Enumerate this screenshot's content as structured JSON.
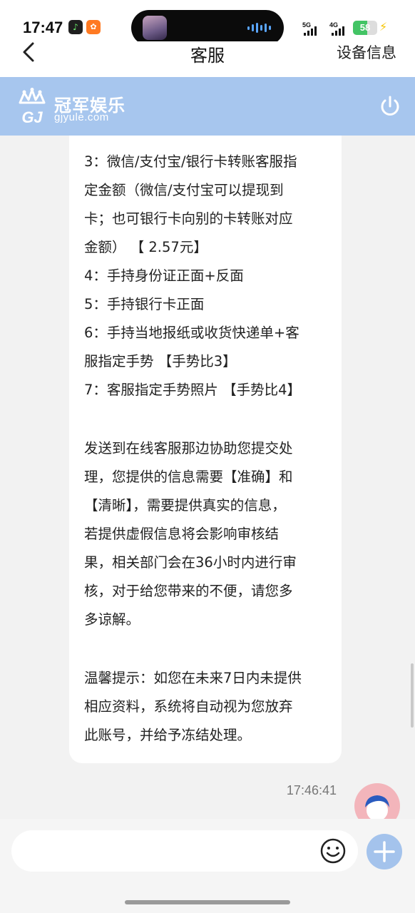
{
  "status_bar": {
    "time": "17:47",
    "signal_1": "5G",
    "signal_2": "4G",
    "battery": "58",
    "battery_level": 0.58,
    "colors": {
      "battery": "#43c465",
      "bolt": "#f5c400"
    }
  },
  "nav": {
    "back_icon": "chevron-left-icon",
    "title": "客服",
    "right_label": "设备信息"
  },
  "brand": {
    "name": "冠军娱乐",
    "url": "gjyule.com",
    "logo_letters": "GJ",
    "power_icon": "power-icon",
    "color": "#a7c6ee"
  },
  "chat": {
    "message_lines": [
      "3：微信/支付宝/银行卡转账客服指",
      "定金额（微信/支付宝可以提现到",
      "卡；也可银行卡向别的卡转账对应",
      "金额）  【 2.57元】",
      "4：手持身份证正面+反面",
      "5：手持银行卡正面",
      "6：手持当地报纸或收货快递单+客",
      "服指定手势 【手势比3】",
      "7：客服指定手势照片  【手势比4】",
      "发送到在线客服那边协助您提交处",
      "理，您提供的信息需要【准确】和",
      "【清晰】，需要提供真实的信息，",
      "若提供虚假信息将会影响审核结",
      "果，相关部门会在36小时内进行审",
      "核，对于给您带来的不便，请您多",
      "多谅解。",
      "温馨提示：如您在未来7日内未提供",
      "相应资料，系统将自动视为您放弃",
      "此账号，并给予冻结处理。"
    ],
    "timestamp": "17:46:41",
    "avatar_icon": "user-avatar-icon"
  },
  "input_bar": {
    "placeholder": "",
    "emoji_icon": "smiley-icon",
    "plus_icon": "plus-icon",
    "plus_color": "#a4c3ec"
  }
}
